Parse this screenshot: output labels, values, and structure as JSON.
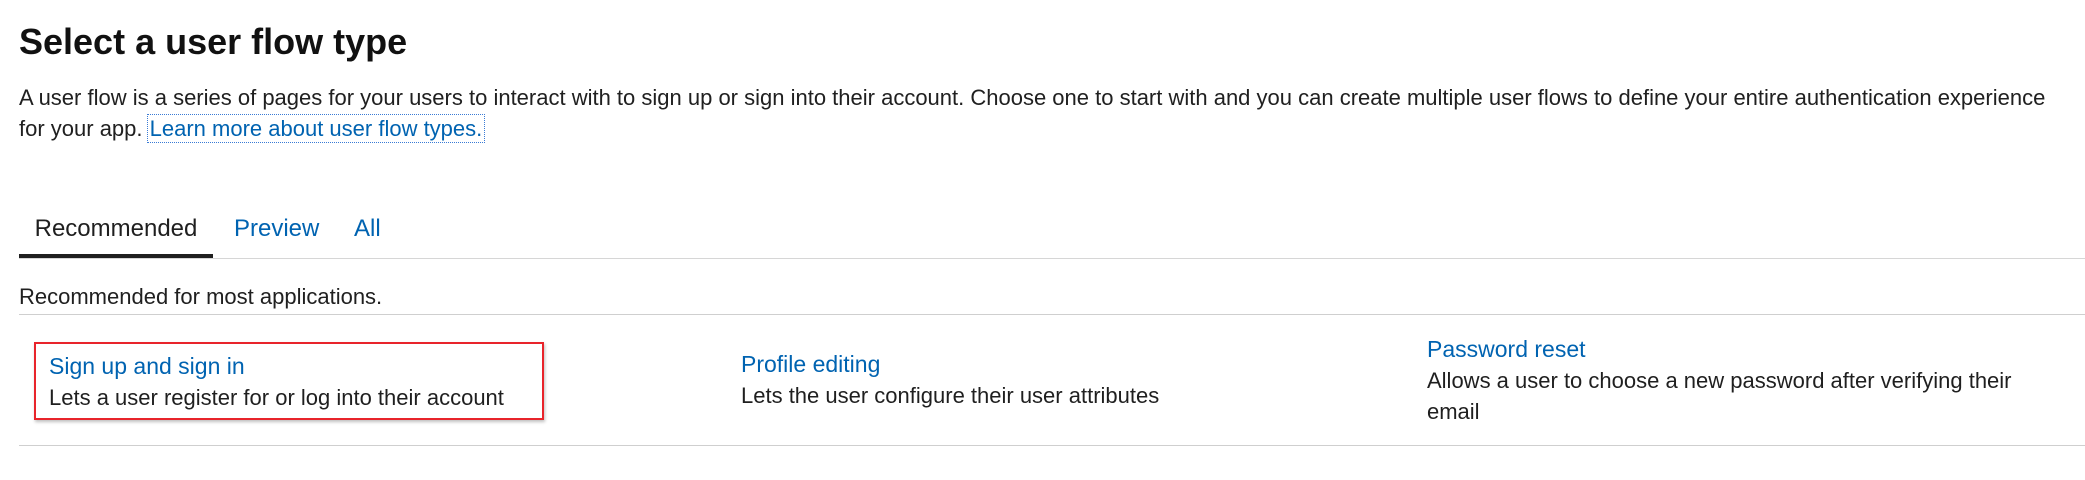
{
  "header": {
    "title": "Select a user flow type",
    "description": "A user flow is a series of pages for your users to interact with to sign up or sign into their account. Choose one to start with and you can create multiple user flows to define your entire authentication experience for your app.",
    "learn_more_link": "Learn more about user flow types."
  },
  "tabs": [
    {
      "label": "Recommended",
      "active": true
    },
    {
      "label": "Preview",
      "active": false
    },
    {
      "label": "All",
      "active": false
    }
  ],
  "section": {
    "description": "Recommended for most applications."
  },
  "flow_types": [
    {
      "title": "Sign up and sign in",
      "description": "Lets a user register for or log into their account",
      "highlighted": true
    },
    {
      "title": "Profile editing",
      "description": "Lets the user configure their user attributes",
      "highlighted": false
    },
    {
      "title": "Password reset",
      "description": "Allows a user to choose a new password after verifying their email",
      "highlighted": false
    }
  ],
  "colors": {
    "link": "#0063b1",
    "highlight_border": "#e8242b",
    "active_tab_underline": "#1f1f1f"
  }
}
